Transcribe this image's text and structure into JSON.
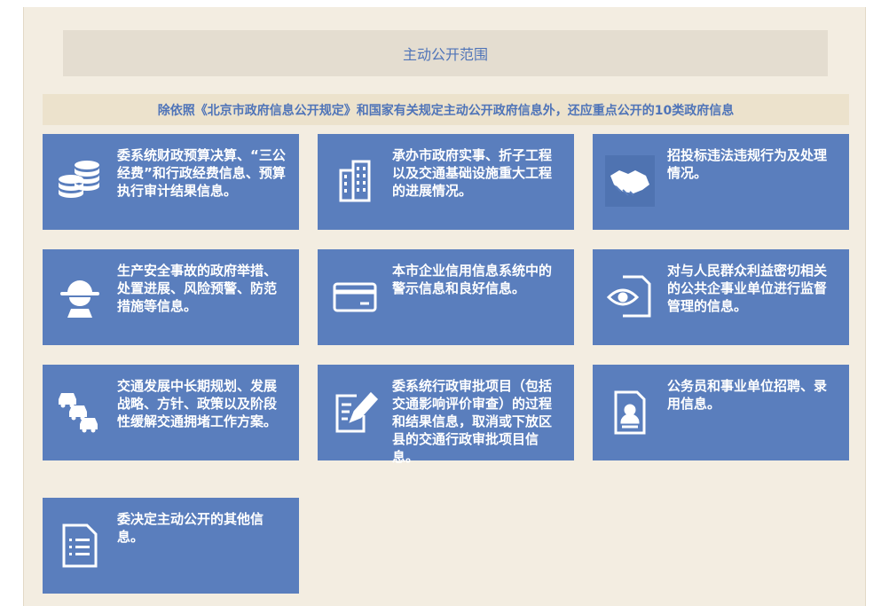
{
  "header": {
    "title": "主动公开范围"
  },
  "notice": {
    "text": "除依照《北京市政府信息公开规定》和国家有关规定主动公开政府信息外，还应重点公开的10类政府信息"
  },
  "cards": [
    {
      "text": "委系统财政预算决算、“三公经费”和行政经费信息、预算执行审计结果信息。",
      "icon": "coins-icon"
    },
    {
      "text": "承办市政府实事、折子工程以及交通基础设施重大工程的进展情况。",
      "icon": "building-icon"
    },
    {
      "text": "招投标违法违规行为及处理情况。",
      "icon": "handshake-icon"
    },
    {
      "text": "生产安全事故的政府举措、处置进展、风险预警、防范措施等信息。",
      "icon": "safety-helmet-icon"
    },
    {
      "text": "本市企业信用信息系统中的警示信息和良好信息。",
      "icon": "credit-card-icon"
    },
    {
      "text": "对与人民群众利益密切相关的公共企事业单位进行监督管理的信息。",
      "icon": "eye-document-icon"
    },
    {
      "text": "交通发展中长期规划、发展战略、方针、政策以及阶段性缓解交通拥堵工作方案。",
      "icon": "traffic-cars-icon"
    },
    {
      "text": "委系统行政审批项目（包括交通影响评价审查）的过程和结果信息，取消或下放区县的交通行政审批项目信息。",
      "icon": "edit-document-icon"
    },
    {
      "text": "公务员和事业单位招聘、录用信息。",
      "icon": "id-profile-icon"
    },
    {
      "text": "委决定主动公开的其他信息。",
      "icon": "list-document-icon"
    }
  ],
  "colors": {
    "card": "#5a7ebd",
    "panel": "#f3ede1",
    "accent": "#4f74b8"
  }
}
